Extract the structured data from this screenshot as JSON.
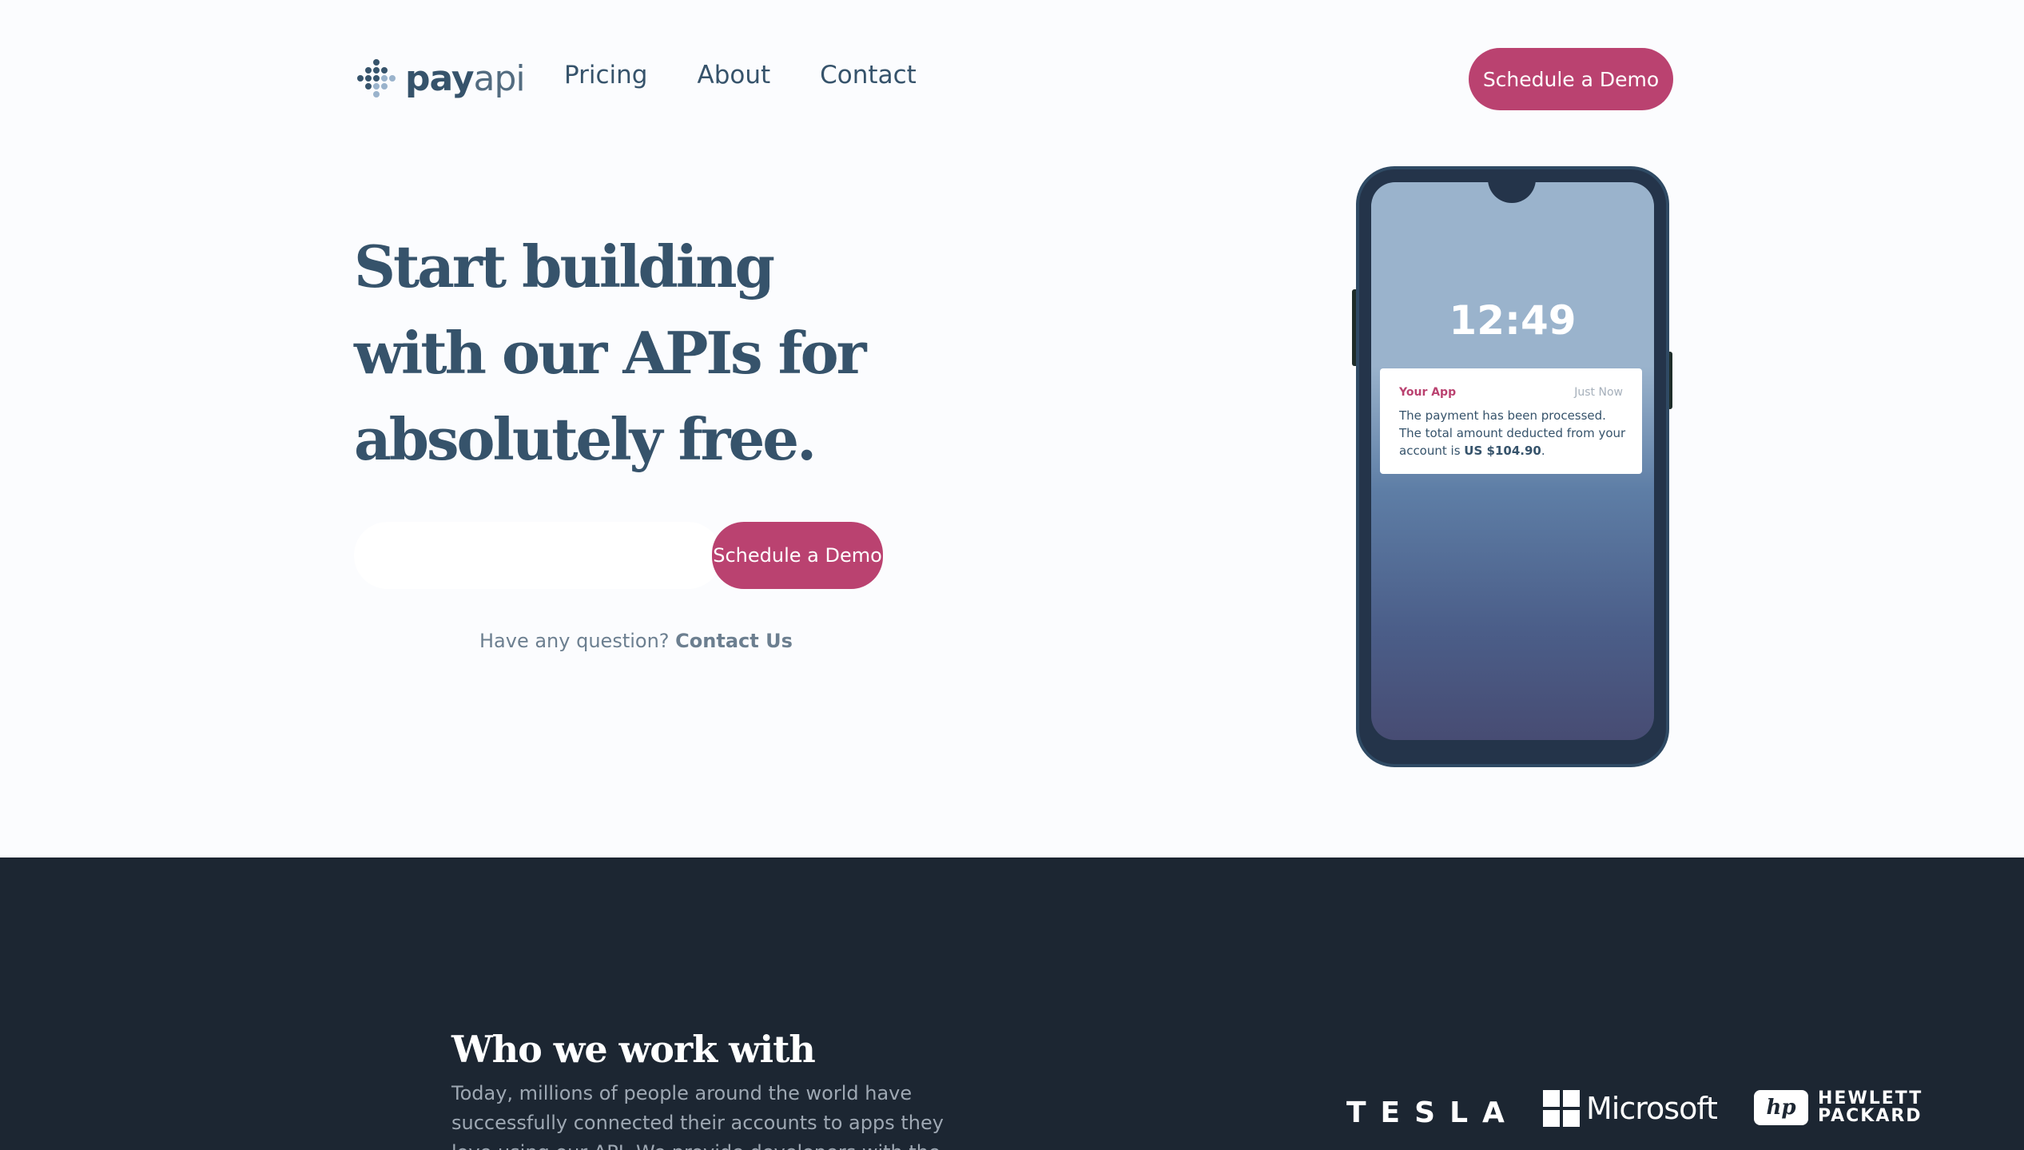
{
  "brand": {
    "name_bold": "pay",
    "name_light": "api"
  },
  "nav": {
    "items": [
      {
        "label": "Pricing"
      },
      {
        "label": "About"
      },
      {
        "label": "Contact"
      }
    ]
  },
  "header": {
    "cta_label": "Schedule a Demo"
  },
  "hero": {
    "title_line1": "Start building",
    "title_line2": "with our APIs for",
    "title_line3": "absolutely free.",
    "email_placeholder": "",
    "cta_label": "Schedule a Demo",
    "question_text": "Have any question?",
    "question_link": "Contact Us"
  },
  "phone": {
    "time": "12:49",
    "notification": {
      "app": "Your App",
      "time": "Just Now",
      "line1": "The payment has been processed.",
      "line2": "The total amount deducted from your",
      "line3_prefix": "account is",
      "amount": "US $104.90",
      "line3_suffix": "."
    }
  },
  "partners": {
    "title": "Who we work with",
    "text": "Today, millions of people around the world have successfully connected their accounts to apps they love using our API. We provide developers with the tools",
    "logos": {
      "tesla": "TESLA",
      "microsoft": "Microsoft",
      "hp_mark": "hp",
      "hp_line1": "HEWLETT",
      "hp_line2": "PACKARD"
    }
  },
  "colors": {
    "accent": "#ba4270",
    "primary_text": "#36536b",
    "dark_band": "#1c2632",
    "background": "#fbfcfe"
  }
}
